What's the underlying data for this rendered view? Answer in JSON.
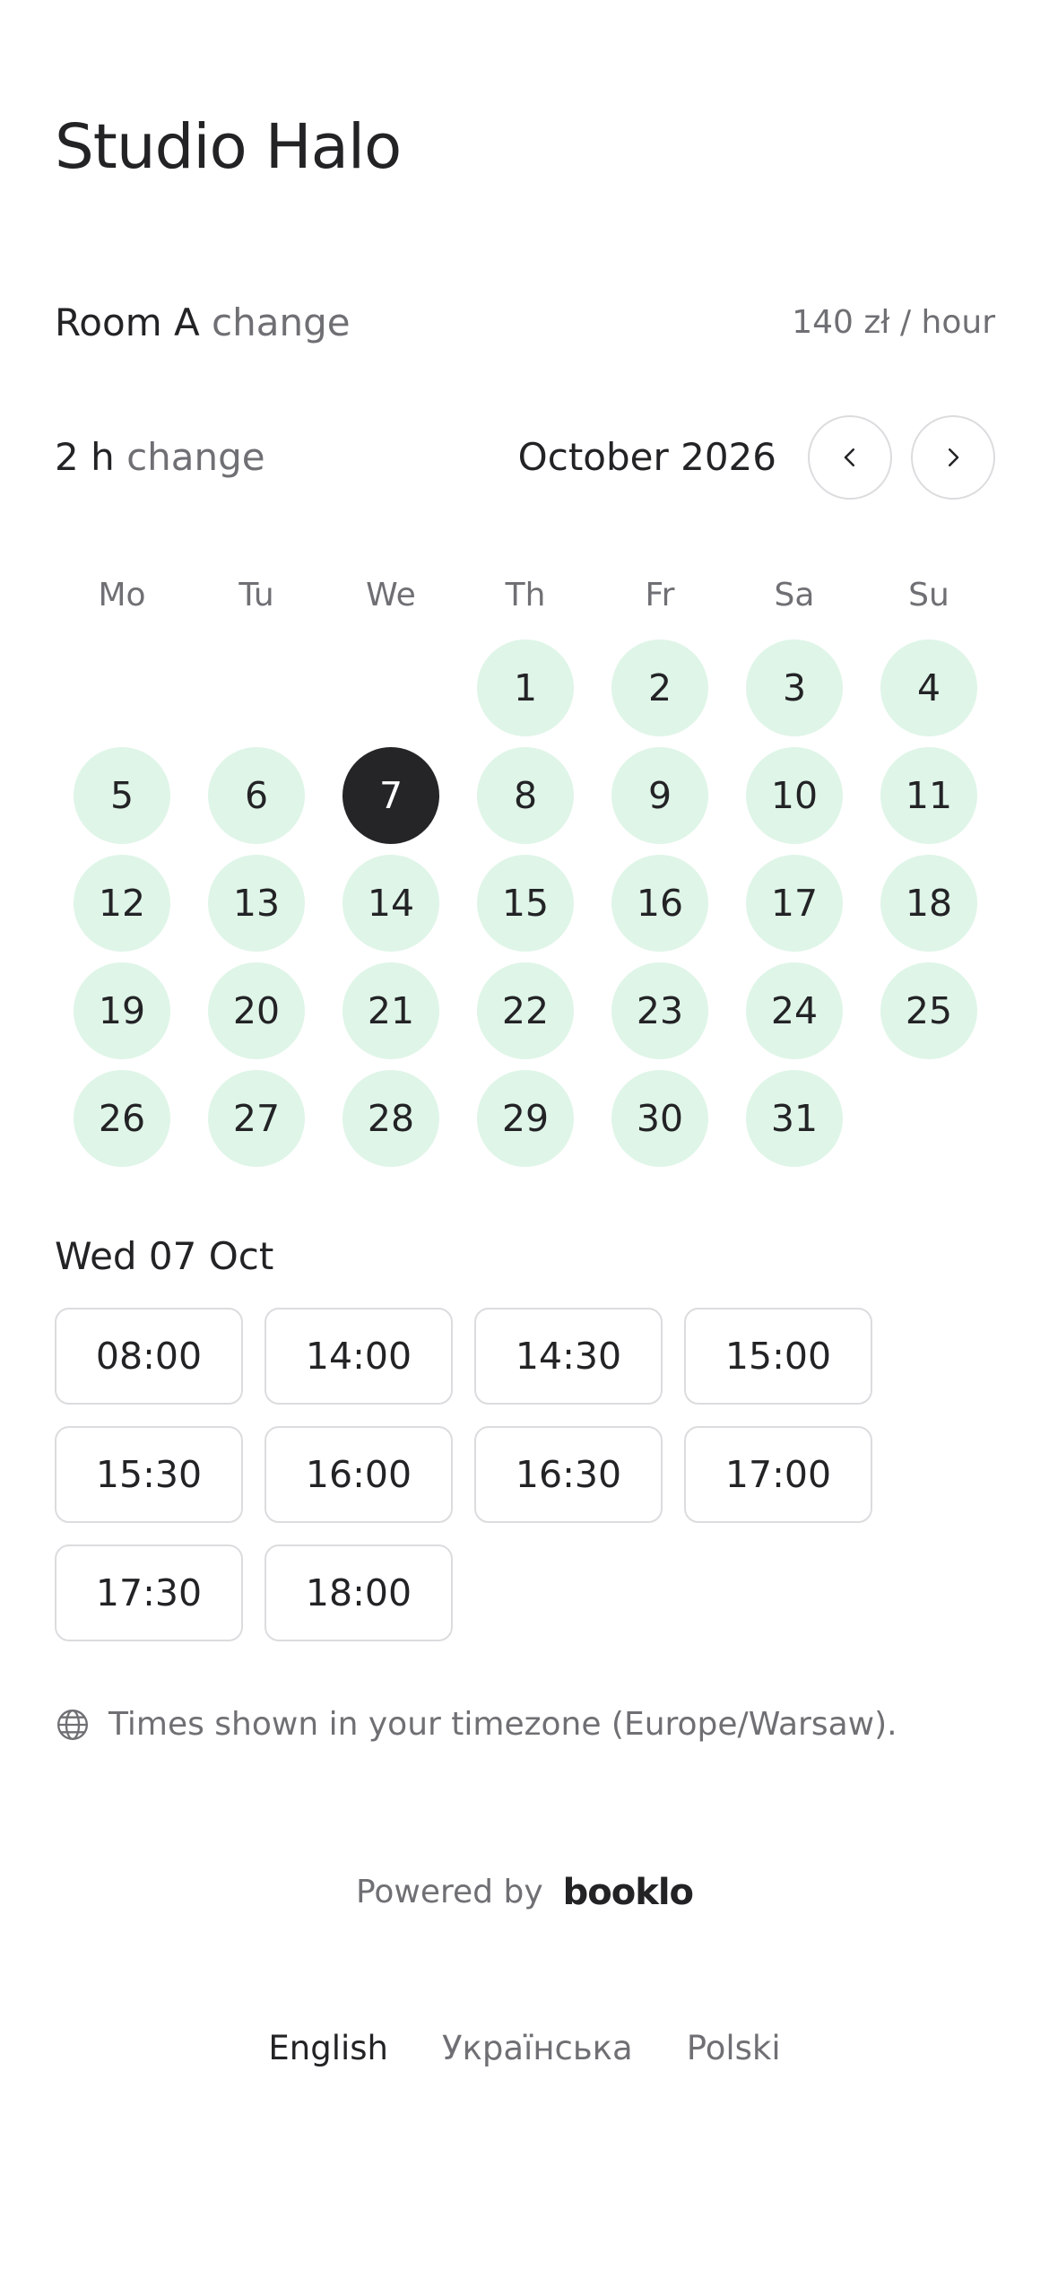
{
  "studio": {
    "name": "Studio Halo"
  },
  "room": {
    "label": "Room A",
    "change_label": "change",
    "price": "140 zł / hour"
  },
  "duration": {
    "label": "2 h",
    "change_label": "change"
  },
  "calendar": {
    "month_label": "October 2026",
    "weekdays": [
      "Mo",
      "Tu",
      "We",
      "Th",
      "Fr",
      "Sa",
      "Su"
    ],
    "leading_blanks": 3,
    "days": [
      "1",
      "2",
      "3",
      "4",
      "5",
      "6",
      "7",
      "8",
      "9",
      "10",
      "11",
      "12",
      "13",
      "14",
      "15",
      "16",
      "17",
      "18",
      "19",
      "20",
      "21",
      "22",
      "23",
      "24",
      "25",
      "26",
      "27",
      "28",
      "29",
      "30",
      "31"
    ],
    "selected_day": "7",
    "colors": {
      "available": "#dff5e8",
      "selected": "#252528"
    }
  },
  "selected_date": {
    "label": "Wed 07 Oct"
  },
  "slots": [
    "08:00",
    "14:00",
    "14:30",
    "15:00",
    "15:30",
    "16:00",
    "16:30",
    "17:00",
    "17:30",
    "18:00"
  ],
  "timezone": {
    "text": "Times shown in your timezone (Europe/Warsaw).",
    "icon": "globe-icon"
  },
  "footer": {
    "powered_by": "Powered by",
    "brand": "booklo"
  },
  "languages": [
    {
      "label": "English",
      "active": true
    },
    {
      "label": "Українська",
      "active": false
    },
    {
      "label": "Polski",
      "active": false
    }
  ]
}
